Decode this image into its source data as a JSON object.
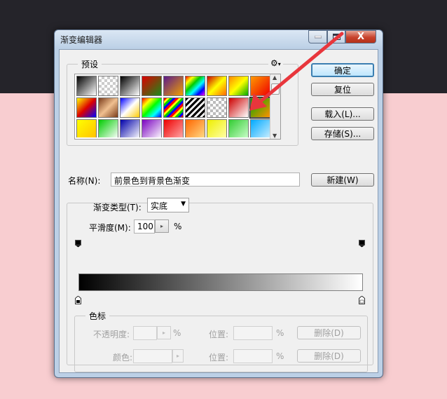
{
  "window": {
    "title": "渐变编辑器",
    "close_glyph": "X"
  },
  "presets": {
    "label": "预设",
    "gear_glyph": "⚙",
    "gear_caret": "▾"
  },
  "buttons": {
    "ok": "确定",
    "reset": "复位",
    "load": "载入(L)...",
    "save": "存储(S)...",
    "new": "新建(W)",
    "delete": "删除(D)"
  },
  "name_field": {
    "label": "名称(N):",
    "value": "前景色到背景色渐变"
  },
  "gradient_type": {
    "label": "渐变类型(T):",
    "value": "实底"
  },
  "smoothness": {
    "label": "平滑度(M):",
    "value": "100",
    "unit": "%"
  },
  "color_stops": {
    "label": "色标",
    "opacity_label": "不透明度:",
    "opacity_value": "",
    "color_label": "颜色:",
    "location_label": "位置:",
    "location_value": "",
    "percent": "%"
  },
  "gradient_bar": {
    "from_color": "#000000",
    "to_color": "#ffffff"
  },
  "annotation": {
    "arrow_color": "#e8363c"
  }
}
